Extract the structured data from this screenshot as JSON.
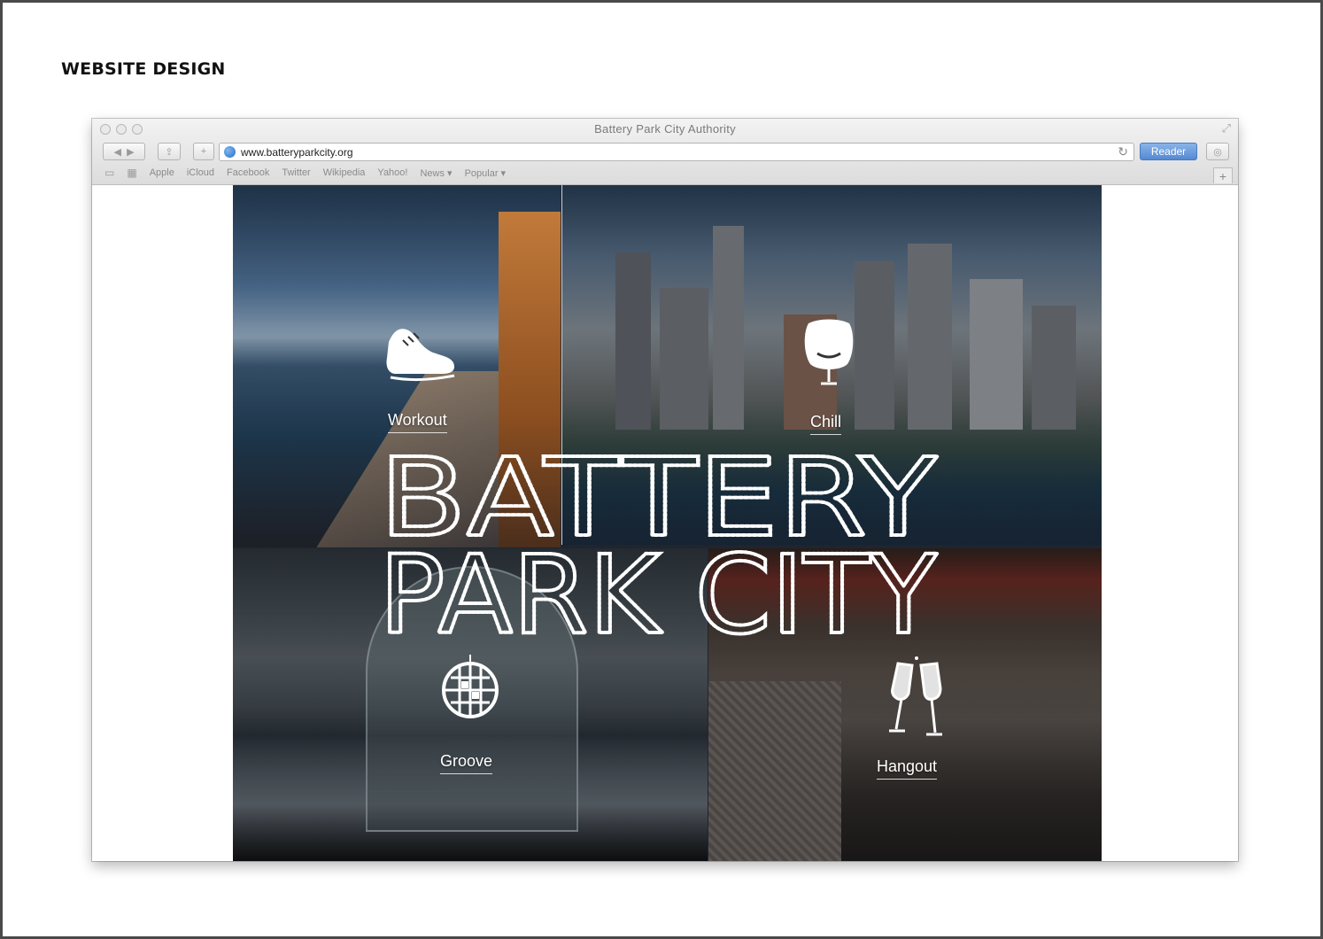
{
  "page": {
    "heading": "WEBSITE DESIGN"
  },
  "browser": {
    "window_title": "Battery Park City Authority",
    "url": "www.batteryparkcity.org",
    "reader_label": "Reader",
    "nav_back_icon": "back-arrow-icon",
    "nav_forward_icon": "forward-arrow-icon",
    "bookmarks": [
      "Apple",
      "iCloud",
      "Facebook",
      "Twitter",
      "Wikipedia",
      "Yahoo!",
      "News ▾",
      "Popular ▾"
    ]
  },
  "site": {
    "logo_line1": "BATTERY",
    "logo_line2": "PARK CITY",
    "tiles": {
      "workout": {
        "label": "Workout",
        "icon": "sneaker-icon"
      },
      "chill": {
        "label": "Chill",
        "icon": "egg-chair-icon"
      },
      "groove": {
        "label": "Groove",
        "icon": "disco-ball-icon"
      },
      "hangout": {
        "label": "Hangout",
        "icon": "champagne-glasses-icon"
      }
    }
  },
  "colors": {
    "reader_button": "#5489d2",
    "frame_border": "#4a4a4a",
    "overlay_text": "#ffffff"
  }
}
